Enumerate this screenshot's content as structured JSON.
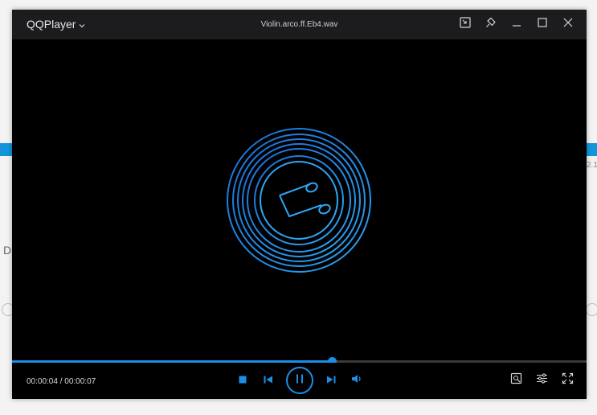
{
  "app": {
    "name": "QQPlayer",
    "file_name": "Violin.arco.ff.Eb4.wav"
  },
  "playback": {
    "current_time": "00:00:04",
    "total_time": "00:00:07",
    "time_separator": " / ",
    "progress_fraction": 0.557
  },
  "background": {
    "left_letter": "D",
    "right_number": "2.1"
  },
  "colors": {
    "accent": "#1a8fe6",
    "window_bg": "#000000",
    "titlebar_bg": "#1c1c1e"
  },
  "icons": {
    "title_menu": "chevron-down-icon",
    "mini_mode": "mini-mode-icon",
    "pin": "pin-icon",
    "minimize": "minimize-icon",
    "maximize": "maximize-icon",
    "close": "close-icon",
    "stop": "stop-icon",
    "previous": "previous-icon",
    "pause": "pause-icon",
    "next": "next-icon",
    "volume": "volume-icon",
    "screenshot": "screenshot-icon",
    "settings": "settings-icon",
    "fullscreen": "fullscreen-icon"
  }
}
